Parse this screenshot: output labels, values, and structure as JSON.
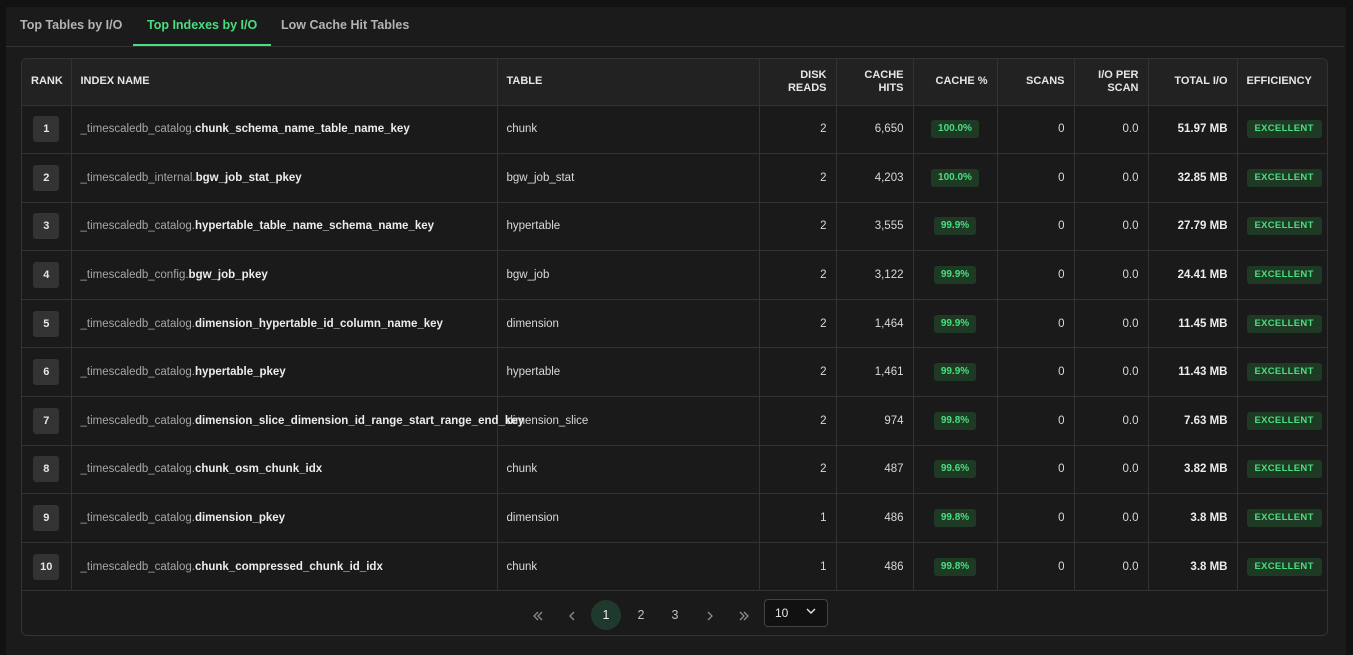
{
  "tabs": [
    {
      "label": "Top Tables by I/O",
      "active": false
    },
    {
      "label": "Top Indexes by I/O",
      "active": true
    },
    {
      "label": "Low Cache Hit Tables",
      "active": false
    }
  ],
  "columns": {
    "rank": "RANK",
    "index_name": "INDEX NAME",
    "table": "TABLE",
    "disk_reads": "DISK READS",
    "cache_hits": "CACHE HITS",
    "cache_pct": "CACHE %",
    "scans": "SCANS",
    "io_per_scan": "I/O PER SCAN",
    "total_io": "TOTAL I/O",
    "efficiency": "EFFICIENCY"
  },
  "rows": [
    {
      "rank": "1",
      "schema": "_timescaledb_catalog.",
      "index": "chunk_schema_name_table_name_key",
      "table": "chunk",
      "disk_reads": "2",
      "cache_hits": "6,650",
      "cache_pct": "100.0%",
      "scans": "0",
      "io_per_scan": "0.0",
      "total_io": "51.97 MB",
      "efficiency": "EXCELLENT"
    },
    {
      "rank": "2",
      "schema": "_timescaledb_internal.",
      "index": "bgw_job_stat_pkey",
      "table": "bgw_job_stat",
      "disk_reads": "2",
      "cache_hits": "4,203",
      "cache_pct": "100.0%",
      "scans": "0",
      "io_per_scan": "0.0",
      "total_io": "32.85 MB",
      "efficiency": "EXCELLENT"
    },
    {
      "rank": "3",
      "schema": "_timescaledb_catalog.",
      "index": "hypertable_table_name_schema_name_key",
      "table": "hypertable",
      "disk_reads": "2",
      "cache_hits": "3,555",
      "cache_pct": "99.9%",
      "scans": "0",
      "io_per_scan": "0.0",
      "total_io": "27.79 MB",
      "efficiency": "EXCELLENT"
    },
    {
      "rank": "4",
      "schema": "_timescaledb_config.",
      "index": "bgw_job_pkey",
      "table": "bgw_job",
      "disk_reads": "2",
      "cache_hits": "3,122",
      "cache_pct": "99.9%",
      "scans": "0",
      "io_per_scan": "0.0",
      "total_io": "24.41 MB",
      "efficiency": "EXCELLENT"
    },
    {
      "rank": "5",
      "schema": "_timescaledb_catalog.",
      "index": "dimension_hypertable_id_column_name_key",
      "table": "dimension",
      "disk_reads": "2",
      "cache_hits": "1,464",
      "cache_pct": "99.9%",
      "scans": "0",
      "io_per_scan": "0.0",
      "total_io": "11.45 MB",
      "efficiency": "EXCELLENT"
    },
    {
      "rank": "6",
      "schema": "_timescaledb_catalog.",
      "index": "hypertable_pkey",
      "table": "hypertable",
      "disk_reads": "2",
      "cache_hits": "1,461",
      "cache_pct": "99.9%",
      "scans": "0",
      "io_per_scan": "0.0",
      "total_io": "11.43 MB",
      "efficiency": "EXCELLENT"
    },
    {
      "rank": "7",
      "schema": "_timescaledb_catalog.",
      "index": "dimension_slice_dimension_id_range_start_range_end_key",
      "table": "dimension_slice",
      "disk_reads": "2",
      "cache_hits": "974",
      "cache_pct": "99.8%",
      "scans": "0",
      "io_per_scan": "0.0",
      "total_io": "7.63 MB",
      "efficiency": "EXCELLENT"
    },
    {
      "rank": "8",
      "schema": "_timescaledb_catalog.",
      "index": "chunk_osm_chunk_idx",
      "table": "chunk",
      "disk_reads": "2",
      "cache_hits": "487",
      "cache_pct": "99.6%",
      "scans": "0",
      "io_per_scan": "0.0",
      "total_io": "3.82 MB",
      "efficiency": "EXCELLENT"
    },
    {
      "rank": "9",
      "schema": "_timescaledb_catalog.",
      "index": "dimension_pkey",
      "table": "dimension",
      "disk_reads": "1",
      "cache_hits": "486",
      "cache_pct": "99.8%",
      "scans": "0",
      "io_per_scan": "0.0",
      "total_io": "3.8 MB",
      "efficiency": "EXCELLENT"
    },
    {
      "rank": "10",
      "schema": "_timescaledb_catalog.",
      "index": "chunk_compressed_chunk_id_idx",
      "table": "chunk",
      "disk_reads": "1",
      "cache_hits": "486",
      "cache_pct": "99.8%",
      "scans": "0",
      "io_per_scan": "0.0",
      "total_io": "3.8 MB",
      "efficiency": "EXCELLENT"
    }
  ],
  "pagination": {
    "first": "«",
    "prev": "‹",
    "pages": [
      "1",
      "2",
      "3"
    ],
    "current_page": "1",
    "next": "›",
    "last": "»",
    "page_size": "10"
  },
  "icons": {
    "first": "double-chevron-left-icon",
    "prev": "chevron-left-icon",
    "next": "chevron-right-icon",
    "last": "double-chevron-right-icon",
    "select": "chevron-down-icon"
  },
  "colors": {
    "accent": "#4ade80",
    "badge_bg": "#1e3a25",
    "background": "#1b1b1b"
  }
}
